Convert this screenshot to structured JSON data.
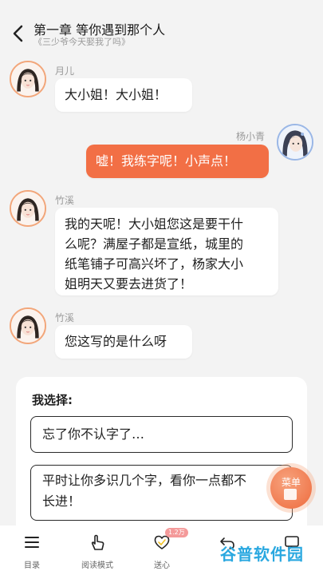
{
  "header": {
    "title": "第一章 等你遇到那个人",
    "subtitle": "《三少爷今天娶我了吗》"
  },
  "messages": [
    {
      "speaker": "月儿",
      "side": "left",
      "avatar_icon": "girl-avatar-icon",
      "text": "大小姐！大小姐！"
    },
    {
      "speaker": "杨小青",
      "side": "right",
      "avatar_icon": "lady-avatar-icon",
      "text": "嘘！我练字呢！小声点！"
    },
    {
      "speaker": "竹溪",
      "side": "left",
      "avatar_icon": "girl-avatar-icon",
      "lines": [
        "我的天呢！大小姐您这是要干什",
        "么呢？满屋子都是宣纸，城里的",
        "纸笔铺子可高兴坏了，杨家大小",
        "姐明天又要去进货了！"
      ]
    },
    {
      "speaker": "竹溪",
      "side": "left",
      "avatar_icon": "girl-avatar-icon",
      "text": "您这写的是什么呀"
    }
  ],
  "choice": {
    "title": "我选择:",
    "options": [
      {
        "text": "忘了你不认字了…"
      },
      {
        "lines": [
          "平时让你多识几个字，看你一点都不",
          "长进！"
        ]
      }
    ]
  },
  "fab": {
    "label": "菜单"
  },
  "nav": {
    "items": [
      {
        "label": "目录",
        "icon": "menu-list-icon"
      },
      {
        "label": "阅读模式",
        "icon": "hand-tap-icon"
      },
      {
        "label": "送心",
        "icon": "heart-icon",
        "badge": "1.2万"
      },
      {
        "label": "",
        "icon": "undo-icon"
      },
      {
        "label": "",
        "icon": "comment-icon"
      }
    ]
  },
  "watermark": "谷普软件园",
  "colors": {
    "accent": "#f26f45",
    "background": "#f3f3f3",
    "watermark": "#2aa8e0"
  }
}
